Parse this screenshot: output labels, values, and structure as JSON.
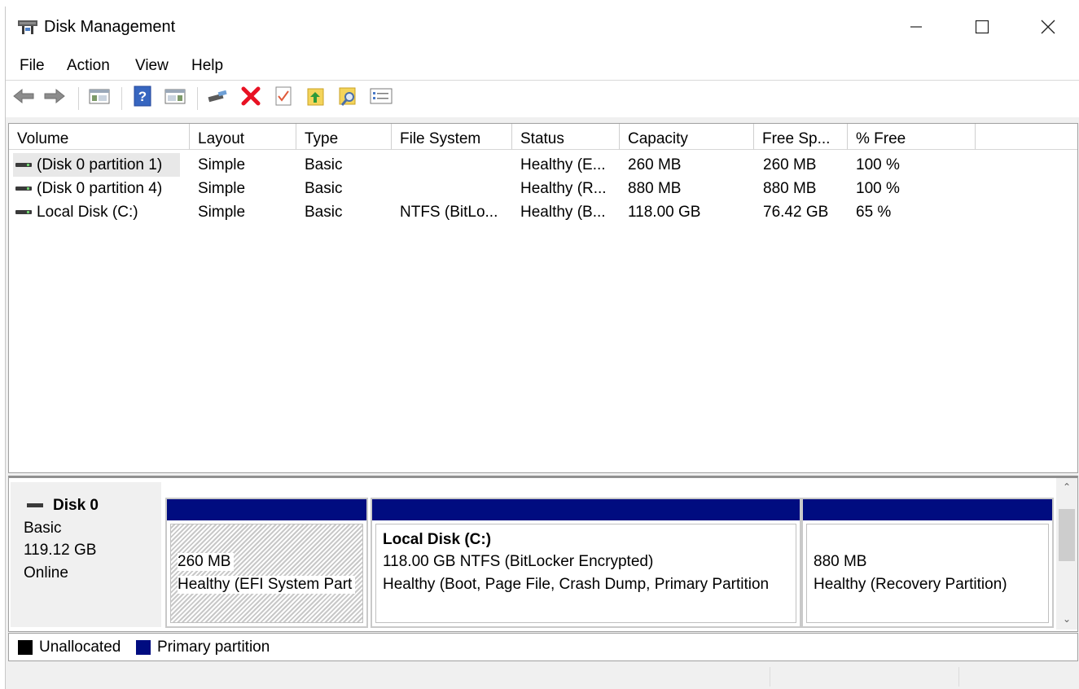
{
  "window": {
    "title": "Disk Management",
    "controls": [
      "minimize-icon",
      "maximize-icon",
      "close-icon"
    ]
  },
  "menu": [
    "File",
    "Action",
    "View",
    "Help"
  ],
  "toolbar": {
    "icons": [
      "back-arrow-icon",
      "forward-arrow-icon",
      "console-tree-icon",
      "help-icon",
      "action-pane-icon",
      "connect-disk-icon",
      "delete-icon",
      "properties-icon",
      "export-list-icon",
      "rescan-icon",
      "settings-list-icon"
    ]
  },
  "volumes": {
    "columns": [
      "Volume",
      "Layout",
      "Type",
      "File System",
      "Status",
      "Capacity",
      "Free Sp...",
      "% Free"
    ],
    "rows": [
      {
        "volume": "(Disk 0 partition 1)",
        "layout": "Simple",
        "type": "Basic",
        "fs": "",
        "status": "Healthy (E...",
        "capacity": "260 MB",
        "free": "260 MB",
        "pct": "100 %"
      },
      {
        "volume": "(Disk 0 partition 4)",
        "layout": "Simple",
        "type": "Basic",
        "fs": "",
        "status": "Healthy (R...",
        "capacity": "880 MB",
        "free": "880 MB",
        "pct": "100 %"
      },
      {
        "volume": "Local Disk (C:)",
        "layout": "Simple",
        "type": "Basic",
        "fs": "NTFS (BitLo...",
        "status": "Healthy (B...",
        "capacity": "118.00 GB",
        "free": "76.42 GB",
        "pct": "65 %"
      }
    ]
  },
  "disk": {
    "name": "Disk 0",
    "type": "Basic",
    "size": "119.12 GB",
    "state": "Online",
    "partitions": [
      {
        "name": "",
        "size": "260 MB",
        "status": "Healthy (EFI System Part"
      },
      {
        "name": "Local Disk  (C:)",
        "size": "118.00 GB NTFS (BitLocker Encrypted)",
        "status": "Healthy (Boot, Page File, Crash Dump, Primary Partition"
      },
      {
        "name": "",
        "size": "880 MB",
        "status": "Healthy (Recovery Partition)"
      }
    ]
  },
  "legend": [
    {
      "label": "Unallocated",
      "color": "#000000"
    },
    {
      "label": "Primary partition",
      "color": "#000c80"
    }
  ],
  "colors": {
    "partition_bar": "#000c80",
    "delete_icon": "#e81123"
  }
}
